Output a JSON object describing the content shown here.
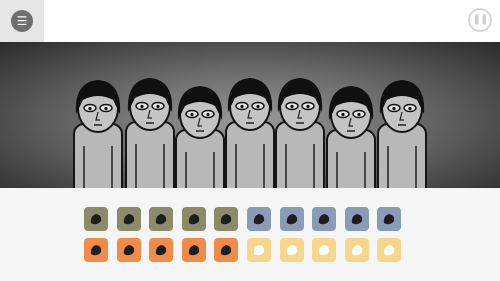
{
  "ui": {
    "menu_glyph": "☰",
    "pause_glyph": "❚❚",
    "colors": {
      "beats": "#8b8b6a",
      "effects": "#8a9bb7",
      "melodies": "#f08b4a",
      "voices": "#f6d68a"
    },
    "icon_rows": [
      [
        "beat-1-icon",
        "beat-2-icon",
        "beat-3-icon",
        "beat-4-icon",
        "beat-5-icon",
        "effect-1-icon",
        "effect-2-icon",
        "effect-3-icon",
        "effect-4-icon",
        "effect-5-icon"
      ],
      [
        "melody-1-icon",
        "melody-2-icon",
        "melody-3-icon",
        "melody-4-icon",
        "melody-5-icon",
        "voice-1-icon",
        "voice-2-icon",
        "voice-3-icon",
        "voice-4-icon",
        "voice-5-icon"
      ]
    ],
    "characters": 7
  }
}
